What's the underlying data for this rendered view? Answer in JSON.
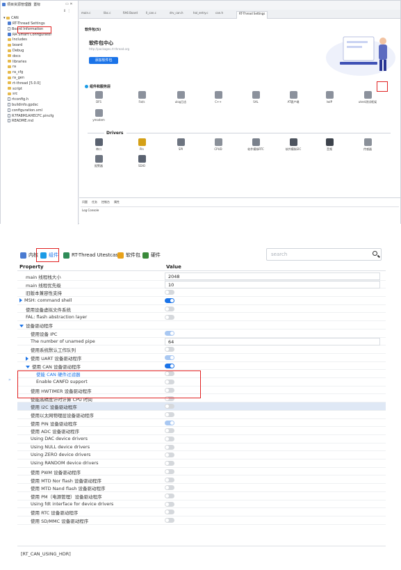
{
  "ide": {
    "project_panel": {
      "tabs": [
        "项目资源管理器",
        "置标"
      ],
      "root": "CAN",
      "items": [
        {
          "label": "RT-Thread Settings",
          "icon": "gear-icon"
        },
        {
          "label": "Board Information",
          "icon": "doc-icon"
        },
        {
          "label": "RA Smart Configurator",
          "icon": "config-icon"
        },
        {
          "label": "Includes",
          "icon": "folder-icon"
        },
        {
          "label": "board",
          "icon": "folder-icon"
        },
        {
          "label": "Debug",
          "icon": "folder-icon"
        },
        {
          "label": "docs",
          "icon": "folder-icon"
        },
        {
          "label": "libraries",
          "icon": "folder-icon"
        },
        {
          "label": "ra",
          "icon": "folder-icon"
        },
        {
          "label": "ra_cfg",
          "icon": "folder-icon"
        },
        {
          "label": "ra_gen",
          "icon": "folder-icon"
        },
        {
          "label": "rt-thread [5.0.0]",
          "icon": "folder-icon"
        },
        {
          "label": "script",
          "icon": "folder-icon"
        },
        {
          "label": "src",
          "icon": "folder-icon"
        },
        {
          "label": "rtconfig.h",
          "icon": "file-icon"
        },
        {
          "label": "buildinfo.gpdsc",
          "icon": "file-icon"
        },
        {
          "label": "configuration.xml",
          "icon": "file-icon"
        },
        {
          "label": "R7FA8M1AHECFC.pincfg",
          "icon": "file-icon"
        },
        {
          "label": "README.md",
          "icon": "file-icon"
        }
      ]
    },
    "editor_tabs": [
      "main.c",
      "libc.c",
      "RA6 Board",
      "ll_can.c",
      "drv_can.h",
      "hal_entry.c",
      "can.h",
      "RT-Thread Settings"
    ],
    "software_header": "软件包(S)",
    "center": {
      "title": "软件包中心",
      "url": "http://packages.rt-thread.org",
      "button": "添加软件包"
    },
    "components_header": "组件和服务层",
    "packages": [
      "DFS",
      "Fal/s",
      "ulog日志",
      "C++",
      "SAL",
      "AT客户端",
      "lwIP",
      "utest测试框架",
      "ymodem"
    ],
    "drivers_header": "Drivers",
    "drivers": [
      "串口",
      "Pin",
      "SPI",
      "CPUD",
      "软件模拟RTC",
      "软件模拟I2C",
      "音频",
      "传感器",
      "报警器",
      "SDIO"
    ],
    "console_tabs": [
      "问题",
      "任务",
      "控制台",
      "属性"
    ],
    "console_title": "Log Console"
  },
  "panel": {
    "toolbar": [
      {
        "label": "内核",
        "icon": "kernel-icon",
        "color": "#4a7bd1"
      },
      {
        "label": "组件",
        "icon": "component-icon",
        "color": "#1a9be6"
      },
      {
        "label": "RT-Thread Utestcases",
        "icon": "utest-icon",
        "color": "#2e8b57"
      },
      {
        "label": "软件包",
        "icon": "package-icon",
        "color": "#e8a21a"
      },
      {
        "label": "硬件",
        "icon": "hardware-icon",
        "color": "#3a8a3a"
      }
    ],
    "search_placeholder": "search",
    "columns": {
      "property": "Property",
      "value": "Value"
    },
    "rows": [
      {
        "label": "main 线程栈大小",
        "indent": 1,
        "type": "text",
        "value": "2048"
      },
      {
        "label": "main 线程优先级",
        "indent": 1,
        "type": "text",
        "value": "10"
      },
      {
        "label": "旧版本兼容性支持",
        "indent": 1,
        "type": "toggle",
        "state": "off"
      },
      {
        "label": "MSH: command shell",
        "indent": 0,
        "caret": "right",
        "type": "toggle",
        "state": "on"
      },
      {
        "label": "使用设备虚拟文件系统",
        "indent": 1,
        "type": "toggle",
        "state": "off"
      },
      {
        "label": "FAL: flash abstraction layer",
        "indent": 1,
        "type": "toggle",
        "state": "off"
      },
      {
        "label": "设备驱动程序",
        "indent": 0,
        "caret": "down",
        "type": "none"
      },
      {
        "label": "使用设备 IPC",
        "indent": 2,
        "type": "toggle",
        "state": "light"
      },
      {
        "label": "The number of unamed pipe",
        "indent": 2,
        "type": "text",
        "value": "64"
      },
      {
        "label": "使用系统默认工作队列",
        "indent": 2,
        "type": "toggle",
        "state": "off"
      },
      {
        "label": "使用 UART 设备驱动程序",
        "indent": 1,
        "caret": "right",
        "type": "toggle",
        "state": "light"
      },
      {
        "label": "使用 CAN 设备驱动程序",
        "indent": 1,
        "caret": "down",
        "type": "toggle",
        "state": "on"
      },
      {
        "label": "使能 CAN 硬件过滤器",
        "indent": 3,
        "type": "toggle",
        "state": "off",
        "highlight": true
      },
      {
        "label": "Enable CANFD support",
        "indent": 3,
        "type": "toggle",
        "state": "off"
      },
      {
        "label": "使用 HWTIMER 设备驱动程序",
        "indent": 2,
        "type": "toggle",
        "state": "off"
      },
      {
        "label": "使能高精度计时计算 CPU 时间",
        "indent": 2,
        "type": "toggle",
        "state": "off"
      },
      {
        "label": "使用 I2C 设备驱动程序",
        "indent": 2,
        "type": "toggle",
        "state": "off",
        "selected": true
      },
      {
        "label": "使用以太网物理层设备驱动程序",
        "indent": 2,
        "type": "toggle",
        "state": "off"
      },
      {
        "label": "使用 PIN 设备驱动程序",
        "indent": 2,
        "type": "toggle",
        "state": "light"
      },
      {
        "label": "使用 ADC 设备驱动程序",
        "indent": 2,
        "type": "toggle",
        "state": "off"
      },
      {
        "label": "Using DAC device drivers",
        "indent": 2,
        "type": "toggle",
        "state": "off"
      },
      {
        "label": "Using NULL device drivers",
        "indent": 2,
        "type": "toggle",
        "state": "off"
      },
      {
        "label": "Using ZERO device drivers",
        "indent": 2,
        "type": "toggle",
        "state": "off"
      },
      {
        "label": "Using RANDOM device drivers",
        "indent": 2,
        "type": "toggle",
        "state": "off"
      },
      {
        "label": "使用 PWM 设备驱动程序",
        "indent": 2,
        "type": "toggle",
        "state": "off"
      },
      {
        "label": "使用 MTD Nor flash 设备驱动程序",
        "indent": 2,
        "type": "toggle",
        "state": "off"
      },
      {
        "label": "使用 MTD Nand flash 设备驱动程序",
        "indent": 2,
        "type": "toggle",
        "state": "off"
      },
      {
        "label": "使用 PM（电源管理）设备驱动程序",
        "indent": 2,
        "type": "toggle",
        "state": "off"
      },
      {
        "label": "Using fdt interface for device drivers",
        "indent": 2,
        "type": "toggle",
        "state": "off"
      },
      {
        "label": "使用 RTC 设备驱动程序",
        "indent": 2,
        "type": "toggle",
        "state": "off"
      },
      {
        "label": "使用 SD/MMC 设备驱动程序",
        "indent": 2,
        "type": "toggle",
        "state": "off"
      }
    ],
    "macro": "[RT_CAN_USING_HDR]"
  }
}
